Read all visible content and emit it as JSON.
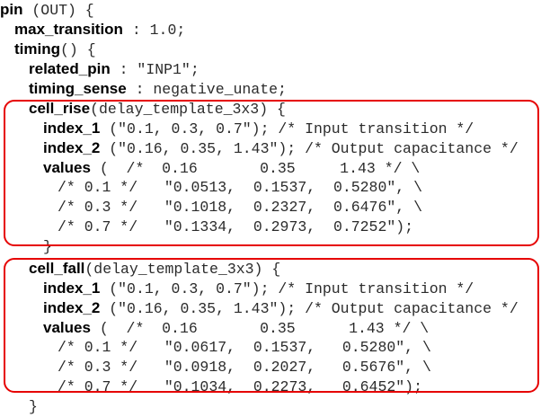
{
  "lines": {
    "l0": {
      "kw": "pin",
      "rest": " (OUT) {"
    },
    "l1": {
      "kw1": "max",
      "kw2": "transition",
      "rest": " : 1.0;"
    },
    "l2": {
      "kw": "timing",
      "rest": "() {"
    },
    "l3": {
      "kw1": "related",
      "kw2": "pin",
      "rest": " : \"INP1\";"
    },
    "l4": {
      "kw1": "timing",
      "kw2": "sense",
      "rest": " : negative_unate;"
    },
    "l5": {
      "kw1": "cell",
      "kw2": "rise",
      "rest": "(delay_template_3x3) {"
    },
    "l6": {
      "kw1": "index",
      "kw2": "1",
      "rest": " (\"0.1, 0.3, 0.7\"); /* Input transition */"
    },
    "l7": {
      "kw1": "index",
      "kw2": "2",
      "rest": " (\"0.16, 0.35, 1.43\"); /* Output capacitance */"
    },
    "l8": {
      "kw": "values",
      "rest": " (  /*  0.16       0.35     1.43 */ \\"
    },
    "l9": {
      "text": "/* 0.1 */   \"0.0513,  0.1537,  0.5280\", \\"
    },
    "l10": {
      "text": "/* 0.3 */   \"0.1018,  0.2327,  0.6476\", \\"
    },
    "l11": {
      "text": "/* 0.7 */   \"0.1334,  0.2973,  0.7252\");"
    },
    "l12": {
      "text": "}"
    },
    "l13": {
      "kw1": "cell",
      "kw2": "fall",
      "rest": "(delay_template_3x3) {"
    },
    "l14": {
      "kw1": "index",
      "kw2": "1",
      "rest": " (\"0.1, 0.3, 0.7\"); /* Input transition */"
    },
    "l15": {
      "kw1": "index",
      "kw2": "2",
      "rest": " (\"0.16, 0.35, 1.43\"); /* Output capacitance */"
    },
    "l16": {
      "kw": "values",
      "rest": " (  /*  0.16       0.35      1.43 */ \\"
    },
    "l17": {
      "text": "/* 0.1 */   \"0.0617,  0.1537,   0.5280\", \\"
    },
    "l18": {
      "text": "/* 0.3 */   \"0.0918,  0.2027,   0.5676\", \\"
    },
    "l19": {
      "text": "/* 0.7 */   \"0.1034,  0.2273,   0.6452\");"
    },
    "l20": {
      "text": "}"
    }
  },
  "colors": {
    "highlight_box": "#e60000",
    "keyword": "#000000",
    "text": "#2b2b2b"
  }
}
